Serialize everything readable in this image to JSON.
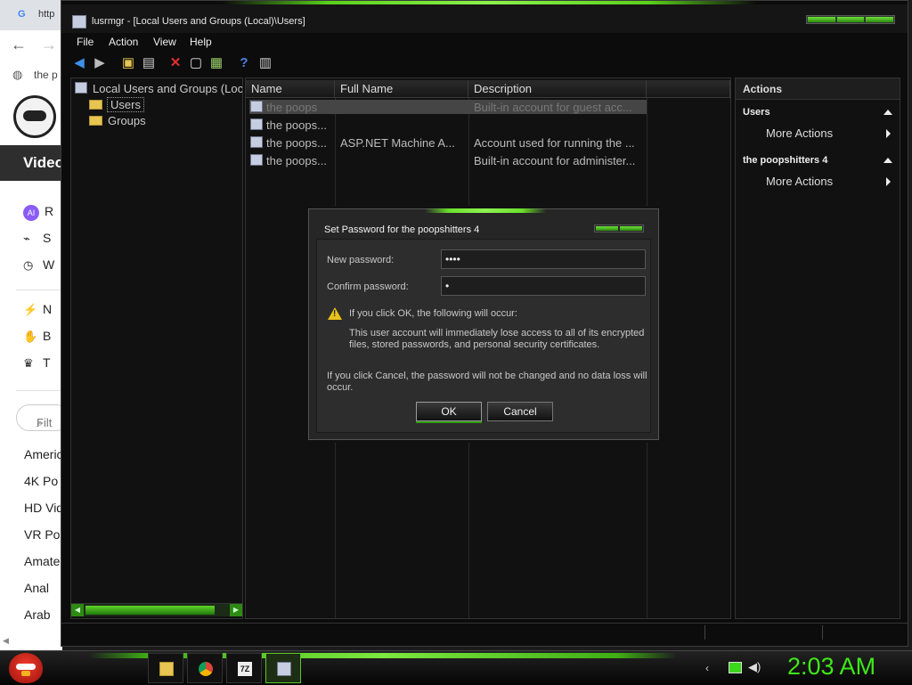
{
  "browser": {
    "tab_text": "http",
    "bookmark_text": "the p",
    "section_label": "Video",
    "menu": [
      {
        "label": "R",
        "icon": "ai-badge-icon"
      },
      {
        "label": "S",
        "icon": "rss-icon"
      },
      {
        "label": "W",
        "icon": "history-icon"
      },
      {
        "label": "N",
        "icon": "lightning-icon"
      },
      {
        "label": "B",
        "icon": "thumbs-up-icon"
      },
      {
        "label": "T",
        "icon": "trophy-icon"
      }
    ],
    "filter_placeholder": "Filt",
    "categories": [
      "Americ",
      "4K Po",
      "HD Vid",
      "VR Po",
      "Amate",
      "Anal",
      "Arab"
    ]
  },
  "window": {
    "title": "lusrmgr - [Local Users and Groups (Local)\\Users]",
    "menu": [
      "File",
      "Action",
      "View",
      "Help"
    ]
  },
  "tree": {
    "root": "Local Users and Groups (Loc",
    "items": [
      "Users",
      "Groups"
    ]
  },
  "list": {
    "columns": [
      "Name",
      "Full Name",
      "Description"
    ],
    "rows": [
      {
        "name": "the poops",
        "full_name": "",
        "description": "Built-in account for guest acc..."
      },
      {
        "name": "the poops...",
        "full_name": "",
        "description": ""
      },
      {
        "name": "the poops...",
        "full_name": "ASP.NET Machine A...",
        "description": "Account used for running the ..."
      },
      {
        "name": "the poops...",
        "full_name": "",
        "description": "Built-in account for administer..."
      }
    ]
  },
  "actions": {
    "header": "Actions",
    "sections": [
      {
        "title": "Users",
        "item": "More Actions"
      },
      {
        "title": "the poopshitters 4",
        "item": "More Actions"
      }
    ]
  },
  "dialog": {
    "title": "Set Password for the poopshitters 4",
    "new_password_label": "New password:",
    "new_password_value": "••••",
    "confirm_password_label": "Confirm password:",
    "confirm_password_value": "•",
    "warning_heading": "If you click OK, the following will occur:",
    "warning_line1": "This user account will immediately lose access to all of its encrypted",
    "warning_line2": "files, stored passwords, and personal security certificates.",
    "cancel_note_line1": "If you click Cancel, the password will not be changed and no data loss will",
    "cancel_note_line2": "occur.",
    "ok_label": "OK",
    "cancel_label": "Cancel"
  },
  "taskbar": {
    "clock": "2:03 AM"
  },
  "colors": {
    "accent_green": "#5ac828",
    "clock_green": "#3ee81a",
    "warning_yellow": "#e8c21a"
  }
}
